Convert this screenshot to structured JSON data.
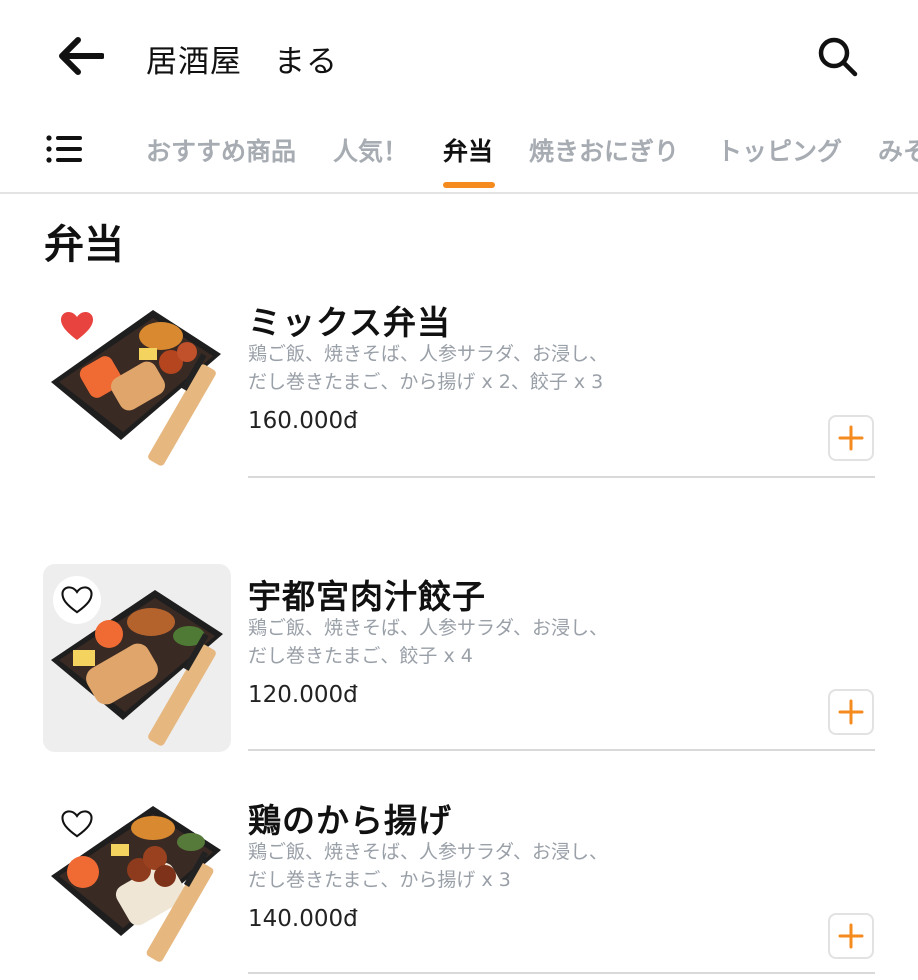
{
  "header": {
    "title": "居酒屋　まる",
    "back_icon": "arrow-left-icon",
    "search_icon": "search-icon"
  },
  "tabs": {
    "menu_icon": "list-icon",
    "items": [
      {
        "label": "おすすめ商品"
      },
      {
        "label": "人気！"
      },
      {
        "label": "弁当"
      },
      {
        "label": "焼きおにぎり"
      },
      {
        "label": "トッピング"
      },
      {
        "label": "みそ"
      }
    ],
    "active": "弁当",
    "accent_color": "#f58a1f"
  },
  "section": {
    "title": "弁当"
  },
  "items": [
    {
      "name": "ミックス弁当",
      "desc_line1": "鶏ご飯、焼きそば、人参サラダ、お浸し、",
      "desc_line2": "だし巻きたまご、から揚げ x 2、餃子 x 3",
      "price": "160.000đ",
      "favorite": true,
      "image": "bento-mix-image"
    },
    {
      "name": "宇都宮肉汁餃子",
      "desc_line1": "鶏ご飯、焼きそば、人参サラダ、お浸し、",
      "desc_line2": "だし巻きたまご、餃子 x 4",
      "price": "120.000đ",
      "favorite": false,
      "image": "bento-gyoza-image"
    },
    {
      "name": "鶏のから揚げ",
      "desc_line1": "鶏ご飯、焼きそば、人参サラダ、お浸し、",
      "desc_line2": "だし巻きたまご、から揚げ x 3",
      "price": "140.000đ",
      "favorite": false,
      "image": "bento-karaage-image"
    }
  ],
  "colors": {
    "heart_filled": "#e8433f",
    "plus": "#f58a1f",
    "muted_text": "#9aa0a8"
  }
}
